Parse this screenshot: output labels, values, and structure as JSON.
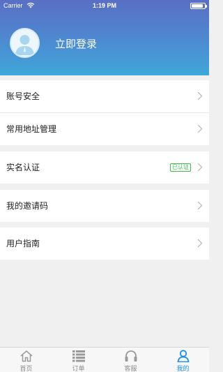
{
  "status_bar": {
    "carrier": "Carrier",
    "time": "1:19 PM",
    "battery_level": 0.9
  },
  "profile": {
    "login_label": "立即登录",
    "avatar_icon": "user-avatar-icon"
  },
  "menu_groups": [
    [
      {
        "label": "账号安全"
      },
      {
        "label": "常用地址管理"
      }
    ],
    [
      {
        "label": "实名认证",
        "badge": "已认证"
      }
    ],
    [
      {
        "label": "我的邀请码"
      }
    ],
    [
      {
        "label": "用户指南"
      }
    ]
  ],
  "tabbar": {
    "tabs": [
      {
        "label": "首页",
        "icon": "home-icon",
        "active": false
      },
      {
        "label": "订单",
        "icon": "order-list-icon",
        "active": false
      },
      {
        "label": "客服",
        "icon": "headset-icon",
        "active": false
      },
      {
        "label": "我的",
        "icon": "person-icon",
        "active": true
      }
    ]
  },
  "colors": {
    "accent": "#1a8fe6",
    "verified": "#3dbb4c",
    "header_top": "#5a6fc3",
    "header_bottom": "#3fa7d9"
  }
}
